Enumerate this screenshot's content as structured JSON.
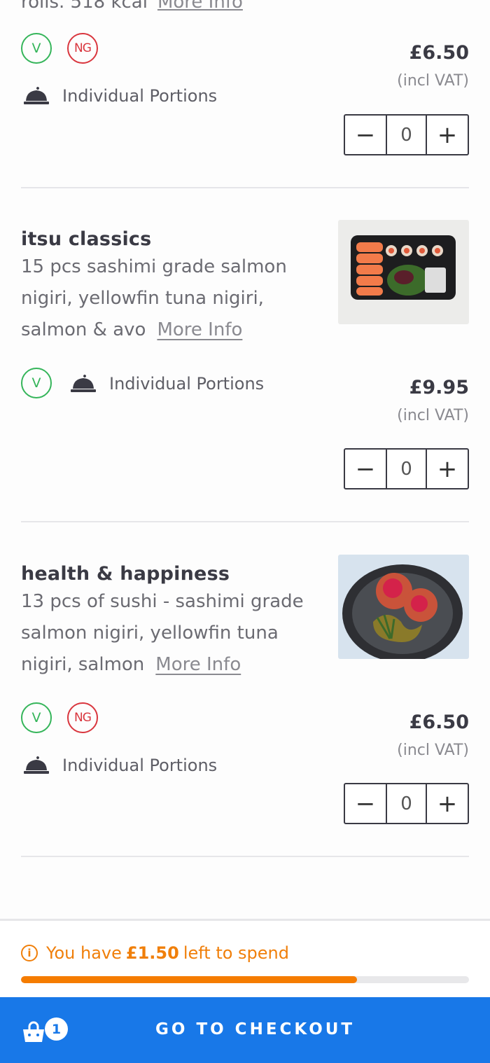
{
  "cut_off": {
    "text": "rolls. 518 kcal",
    "more_label": "More Info"
  },
  "items": [
    {
      "title": "",
      "description": "",
      "more_label": "",
      "badges": [
        "V",
        "NG"
      ],
      "portion": "Individual Portions",
      "price": "£6.50",
      "vat": "(incl VAT)",
      "qty": "0"
    },
    {
      "title": "itsu classics",
      "description": "15 pcs sashimi grade salmon nigiri, yellowfin tuna nigiri, salmon & avo",
      "more_label": "More Info",
      "badges": [
        "V"
      ],
      "portion": "Individual Portions",
      "price": "£9.95",
      "vat": "(incl VAT)",
      "qty": "0"
    },
    {
      "title": "health & happiness",
      "description": "13 pcs of sushi - sashimi grade salmon nigiri, yellowfin tuna nigiri, salmon",
      "more_label": "More Info",
      "badges": [
        "V",
        "NG"
      ],
      "portion": "Individual Portions",
      "price": "£6.50",
      "vat": "(incl VAT)",
      "qty": "0"
    }
  ],
  "stepper": {
    "minus": "−",
    "plus": "+"
  },
  "budget": {
    "prefix": "You have",
    "amount": "£1.50",
    "suffix": "left to spend",
    "progress_fraction": 0.75,
    "color": "#f57c00"
  },
  "checkout": {
    "label": "GO TO CHECKOUT",
    "cart_count": "1",
    "color": "#1878e8"
  },
  "icons": [
    "cloche-icon",
    "info-icon",
    "shopping-bag-icon",
    "minus-icon",
    "plus-icon"
  ]
}
